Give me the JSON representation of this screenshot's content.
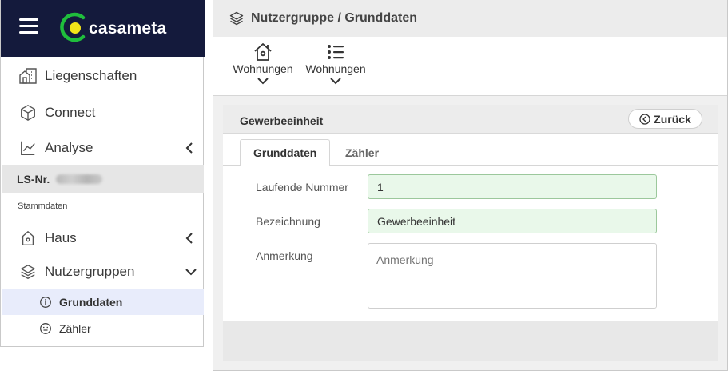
{
  "brand": {
    "name": "casameta",
    "accent": "#1fbd3c",
    "dot": "#f2e419",
    "topbar_bg": "#141a3c"
  },
  "sidebar": {
    "menu_icon": "hamburger-icon",
    "items": [
      {
        "label": "Liegenschaften",
        "icon": "buildings-icon"
      },
      {
        "label": "Connect",
        "icon": "cube-icon"
      },
      {
        "label": "Analyse",
        "icon": "chart-line-icon",
        "chevron": "chevron-left-icon"
      }
    ],
    "ls_label": "LS-Nr.",
    "section_label": "Stammdaten",
    "stammdaten": [
      {
        "label": "Haus",
        "icon": "house-icon",
        "chevron": "chevron-left-icon"
      },
      {
        "label": "Nutzergruppen",
        "icon": "layers-icon",
        "chevron": "chevron-down-icon"
      }
    ],
    "sub_items": [
      {
        "label": "Grunddaten",
        "icon": "info-circle-icon",
        "active": true
      },
      {
        "label": "Zähler",
        "icon": "meter-icon",
        "active": false
      }
    ]
  },
  "main": {
    "title": "Nutzergruppe / Grunddaten",
    "title_icon": "layers-icon",
    "toolbar": [
      {
        "label": "Wohnungen",
        "icon": "house-icon"
      },
      {
        "label": "Wohnungen",
        "icon": "list-icon"
      }
    ],
    "card": {
      "title": "Gewerbeeinheit",
      "back_label": "Zurück",
      "tabs": [
        {
          "label": "Grunddaten",
          "active": true
        },
        {
          "label": "Zähler",
          "active": false
        }
      ],
      "fields": {
        "laufende_nummer": {
          "label": "Laufende Nummer",
          "value": "1"
        },
        "bezeichnung": {
          "label": "Bezeichnung",
          "value": "Gewerbeeinheit"
        },
        "anmerkung": {
          "label": "Anmerkung",
          "value": "",
          "placeholder": "Anmerkung"
        }
      }
    }
  }
}
